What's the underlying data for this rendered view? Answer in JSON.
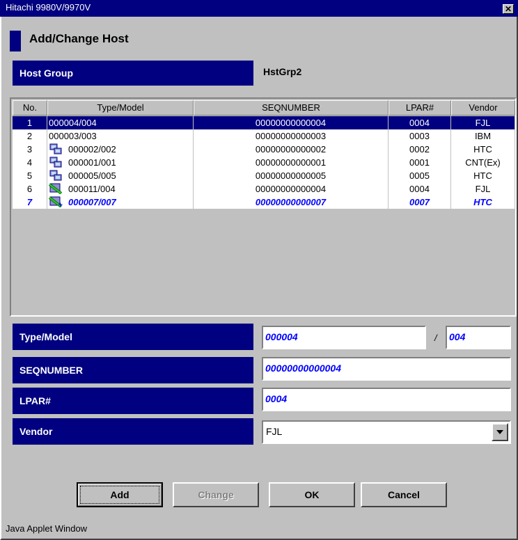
{
  "window": {
    "title": "Hitachi 9980V/9970V",
    "close_glyph": "✕",
    "footer": "Java Applet Window"
  },
  "heading": "Add/Change Host",
  "host_group": {
    "label": "Host Group",
    "value": "HstGrp2"
  },
  "table": {
    "columns": [
      "No.",
      "Type/Model",
      "SEQNUMBER",
      "LPAR#",
      "Vendor"
    ],
    "rows": [
      {
        "no": "1",
        "type_model": "000004/004",
        "seq": "00000000000004",
        "lpar": "0004",
        "vendor": "FJL",
        "icon": "none",
        "state": "selected"
      },
      {
        "no": "2",
        "type_model": "000003/003",
        "seq": "00000000000003",
        "lpar": "0003",
        "vendor": "IBM",
        "icon": "none",
        "state": "normal"
      },
      {
        "no": "3",
        "type_model": "000002/002",
        "seq": "00000000000002",
        "lpar": "0002",
        "vendor": "HTC",
        "icon": "host-computer-icon",
        "state": "normal"
      },
      {
        "no": "4",
        "type_model": "000001/001",
        "seq": "00000000000001",
        "lpar": "0001",
        "vendor": "CNT(Ex)",
        "icon": "host-computer-icon",
        "state": "normal"
      },
      {
        "no": "5",
        "type_model": "000005/005",
        "seq": "00000000000005",
        "lpar": "0005",
        "vendor": "HTC",
        "icon": "host-computer-icon",
        "state": "normal"
      },
      {
        "no": "6",
        "type_model": "000011/004",
        "seq": "00000000000004",
        "lpar": "0004",
        "vendor": "FJL",
        "icon": "modified-host-icon",
        "state": "normal"
      },
      {
        "no": "7",
        "type_model": "000007/007",
        "seq": "00000000000007",
        "lpar": "0007",
        "vendor": "HTC",
        "icon": "added-host-icon",
        "state": "new"
      }
    ]
  },
  "form": {
    "type_model_label": "Type/Model",
    "type_value": "000004",
    "slash": "/",
    "model_value": "004",
    "seq_label": "SEQNUMBER",
    "seq_value": "00000000000004",
    "lpar_label": "LPAR#",
    "lpar_value": "0004",
    "vendor_label": "Vendor",
    "vendor_value": "FJL"
  },
  "buttons": {
    "add": "Add",
    "change": "Change",
    "ok": "OK",
    "cancel": "Cancel"
  },
  "colors": {
    "title_bar": "#000080",
    "label_bg": "#000080",
    "new_row_text": "#0000ff"
  }
}
